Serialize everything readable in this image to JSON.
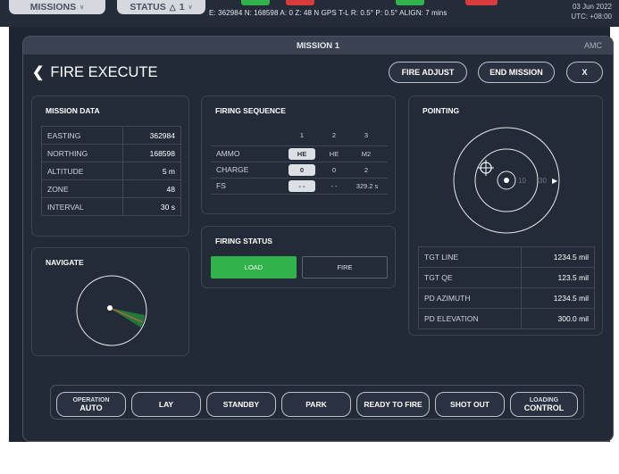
{
  "topbar": {
    "missions_label": "MISSIONS",
    "status_label": "STATUS",
    "status_count": "1",
    "readout": "E: 362984  N: 168598  A: 0  Z: 48  N  GPS  T-L  R: 0.5°  P: 0.5°  ALIGN: 7 mins",
    "date": "03 Jun 2022",
    "utc": "UTC: +08:00",
    "colors": {
      "green": "#2fb34a",
      "red": "#d93b3b"
    }
  },
  "window": {
    "title": "MISSION 1",
    "tag": "AMC"
  },
  "header": {
    "title": "FIRE EXECUTE",
    "fire_adjust": "FIRE ADJUST",
    "end_mission": "END MISSION",
    "close": "X"
  },
  "mission_data": {
    "title": "MISSION DATA",
    "rows": [
      {
        "label": "EASTING",
        "value": "362984"
      },
      {
        "label": "NORTHING",
        "value": "168598"
      },
      {
        "label": "ALTITUDE",
        "value": "5 m"
      },
      {
        "label": "ZONE",
        "value": "48"
      },
      {
        "label": "INTERVAL",
        "value": "30 s"
      }
    ]
  },
  "firing_sequence": {
    "title": "FIRING SEQUENCE",
    "columns": [
      "1",
      "2",
      "3"
    ],
    "rows": [
      {
        "label": "AMMO",
        "values": [
          "HE",
          "HE",
          "M2"
        ]
      },
      {
        "label": "CHARGE",
        "values": [
          "0",
          "0",
          "2"
        ]
      },
      {
        "label": "FS",
        "values": [
          "- -",
          "- -",
          "329.2 s"
        ]
      }
    ]
  },
  "firing_status": {
    "title": "FIRING STATUS",
    "load": "LOAD",
    "fire": "FIRE",
    "load_color": "#2fb34a"
  },
  "pointing": {
    "title": "POINTING",
    "ring_10": "10",
    "ring_30": "30",
    "rows": [
      {
        "label": "TGT LINE",
        "value": "1234.5 mil"
      },
      {
        "label": "TGT QE",
        "value": "123.5 mil"
      },
      {
        "label": "PD AZIMUTH",
        "value": "1234.5 mil"
      },
      {
        "label": "PD ELEVATION",
        "value": "300.0 mil"
      }
    ]
  },
  "navigate": {
    "title": "NAVIGATE",
    "sector_color": "#1f7a3a",
    "heading_color": "#c0623c"
  },
  "bottom": {
    "operation_l1": "OPERATION",
    "operation_l2": "AUTO",
    "lay": "LAY",
    "standby": "STANDBY",
    "park": "PARK",
    "ready": "READY TO FIRE",
    "shot_out": "SHOT OUT",
    "loading_l1": "LOADING",
    "loading_l2": "CONTROL"
  }
}
